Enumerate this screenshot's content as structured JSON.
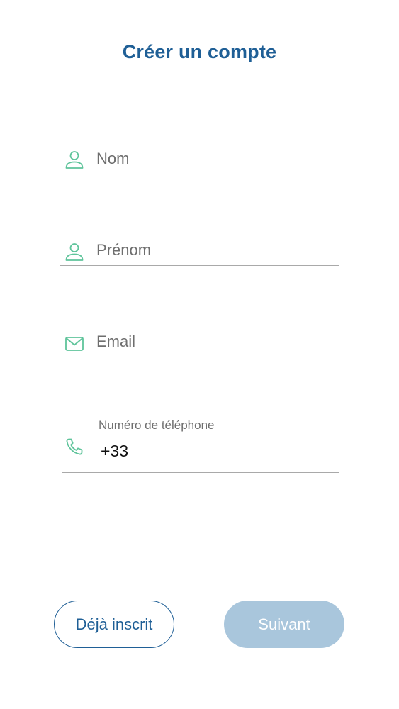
{
  "header": {
    "title": "Créer un compte"
  },
  "form": {
    "nom": {
      "placeholder": "Nom",
      "value": ""
    },
    "prenom": {
      "placeholder": "Prénom",
      "value": ""
    },
    "email": {
      "placeholder": "Email",
      "value": ""
    },
    "phone": {
      "label": "Numéro de téléphone",
      "value": "+33"
    }
  },
  "actions": {
    "secondary_label": "Déjà inscrit",
    "primary_label": "Suivant"
  },
  "icons": {
    "nom": "person-icon",
    "prenom": "person-icon",
    "email": "envelope-icon",
    "phone": "phone-icon"
  },
  "colors": {
    "title": "#1f5f96",
    "icon_accent": "#5fc49b",
    "primary_button_disabled": "#a9c6dc",
    "secondary_button_border": "#1f5f96",
    "underline": "#a9a9a9"
  }
}
